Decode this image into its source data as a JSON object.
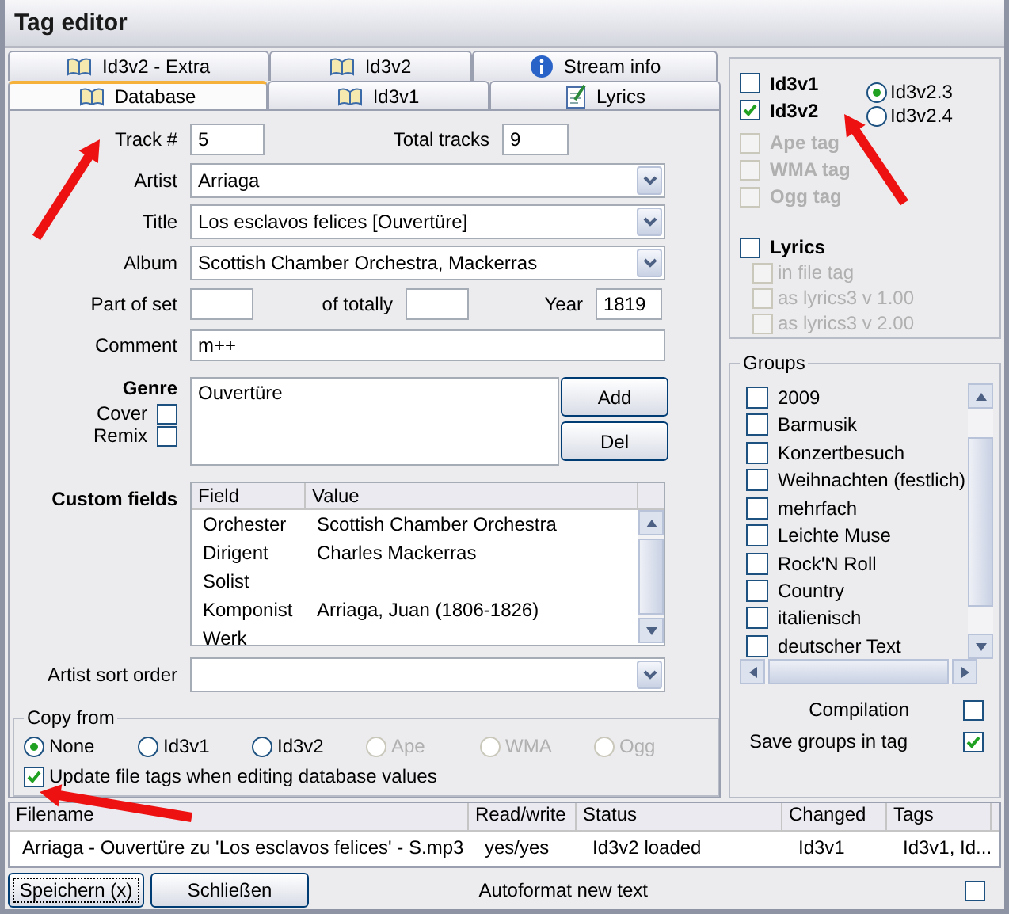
{
  "window": {
    "title": "Tag editor"
  },
  "tabs_back_row": [
    {
      "label": "Id3v2 - Extra",
      "kind": "book",
      "selected": false
    },
    {
      "label": "Id3v2",
      "kind": "book",
      "selected": false
    },
    {
      "label": "Stream info",
      "kind": "info",
      "selected": false
    }
  ],
  "tabs_front_row": [
    {
      "label": "Database",
      "kind": "book",
      "selected": true
    },
    {
      "label": "Id3v1",
      "kind": "book",
      "selected": false
    },
    {
      "label": "Lyrics",
      "kind": "note",
      "selected": false
    }
  ],
  "fields": {
    "track": {
      "label": "Track #",
      "value": "5"
    },
    "total_tracks": {
      "label": "Total tracks",
      "value": "9"
    },
    "artist": {
      "label": "Artist",
      "value": "Arriaga"
    },
    "title": {
      "label": "Title",
      "value": "Los esclavos felices [Ouvertüre]"
    },
    "album": {
      "label": "Album",
      "value": "Scottish Chamber Orchestra, Mackerras"
    },
    "part_of_set": {
      "label": "Part of set"
    },
    "of_totally": {
      "label": "of totally"
    },
    "year": {
      "label": "Year",
      "value": "1819"
    },
    "comment": {
      "label": "Comment",
      "value": "m++"
    }
  },
  "genre": {
    "label": "Genre",
    "items": [
      "Ouvertüre"
    ],
    "cover": {
      "label": "Cover",
      "checked": false
    },
    "remix": {
      "label": "Remix",
      "checked": false
    },
    "buttons": [
      "Add",
      "Del"
    ]
  },
  "custom_fields": {
    "label": "Custom fields",
    "columns": [
      "Field",
      "Value"
    ],
    "rows": [
      [
        "Orchester",
        "Scottish Chamber Orchestra"
      ],
      [
        "Dirigent",
        "Charles Mackerras"
      ],
      [
        "Solist",
        ""
      ],
      [
        "Komponist",
        "Arriaga, Juan (1806-1826)"
      ],
      [
        "Werk",
        ""
      ]
    ]
  },
  "artist_sort_order": {
    "label": "Artist sort order"
  },
  "copy_from": {
    "label": "Copy from",
    "options": [
      {
        "label": "None",
        "selected": true,
        "disabled": false
      },
      {
        "label": "Id3v1",
        "selected": false,
        "disabled": false
      },
      {
        "label": "Id3v2",
        "selected": false,
        "disabled": false
      },
      {
        "label": "Ape",
        "selected": false,
        "disabled": true
      },
      {
        "label": "WMA",
        "selected": false,
        "disabled": true
      },
      {
        "label": "Ogg",
        "selected": false,
        "disabled": true
      }
    ],
    "update": {
      "label": "Update file tags when editing database values",
      "checked": true
    }
  },
  "tag_types": [
    {
      "label": "Id3v1",
      "checked": false,
      "disabled": false
    },
    {
      "label": "Id3v2",
      "checked": true,
      "disabled": false
    },
    {
      "label": "Ape tag",
      "checked": false,
      "disabled": true
    },
    {
      "label": "WMA tag",
      "checked": false,
      "disabled": true
    },
    {
      "label": "Ogg tag",
      "checked": false,
      "disabled": true
    }
  ],
  "id3v2_versions": [
    {
      "label": "Id3v2.3",
      "selected": true
    },
    {
      "label": "Id3v2.4",
      "selected": false
    }
  ],
  "lyrics": {
    "label": "Lyrics",
    "checked": false,
    "options": [
      {
        "label": "in file tag",
        "checked": false,
        "disabled": true
      },
      {
        "label": "as lyrics3 v 1.00",
        "checked": false,
        "disabled": true
      },
      {
        "label": "as lyrics3 v 2.00",
        "checked": false,
        "disabled": true
      }
    ]
  },
  "groups": {
    "title": "Groups",
    "items": [
      {
        "label": "2009",
        "checked": false
      },
      {
        "label": "Barmusik",
        "checked": false
      },
      {
        "label": "Konzertbesuch",
        "checked": false
      },
      {
        "label": "Weihnachten (festlich)",
        "checked": false
      },
      {
        "label": "mehrfach",
        "checked": false
      },
      {
        "label": "Leichte Muse",
        "checked": false
      },
      {
        "label": "Rock'N Roll",
        "checked": false
      },
      {
        "label": "Country",
        "checked": false
      },
      {
        "label": "italienisch",
        "checked": false
      },
      {
        "label": "deutscher Text",
        "checked": false
      }
    ],
    "compilation": {
      "label": "Compilation",
      "checked": false
    },
    "save_groups": {
      "label": "Save groups in tag",
      "checked": true
    }
  },
  "files": {
    "columns": [
      "Filename",
      "Read/write",
      "Status",
      "Changed",
      "Tags"
    ],
    "rows": [
      [
        "Arriaga - Ouvertüre zu 'Los esclavos felices' - S.mp3",
        "yes/yes",
        "Id3v2 loaded",
        "Id3v1",
        "Id3v1, Id..."
      ]
    ]
  },
  "buttons": [
    {
      "label": "Speichern (x)",
      "focused": true
    },
    {
      "label": "Schließen",
      "focused": false
    }
  ],
  "autoformat": {
    "label": "Autoformat new text",
    "checked": false
  }
}
